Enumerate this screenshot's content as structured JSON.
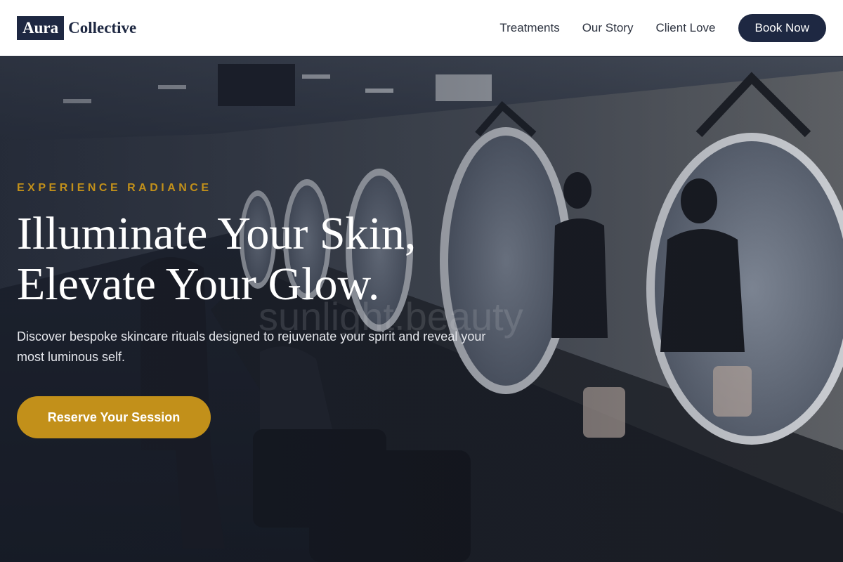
{
  "header": {
    "logo": {
      "box_text": "Aura",
      "text": "Collective"
    },
    "nav": [
      "Treatments",
      "Our Story",
      "Client Love"
    ],
    "book_label": "Book Now"
  },
  "hero": {
    "eyebrow": "EXPERIENCE RADIANCE",
    "headline_line1": "Illuminate Your Skin,",
    "headline_line2": "Elevate Your Glow.",
    "subtext": "Discover bespoke skincare rituals designed to rejuvenate your spirit and reveal your most luminous self.",
    "cta_label": "Reserve Your Session",
    "image_watermark": "sunlight.beauty"
  },
  "colors": {
    "brand_navy": "#1e2842",
    "accent_gold": "#c2901a",
    "header_bg": "#ffffff"
  },
  "icons": []
}
